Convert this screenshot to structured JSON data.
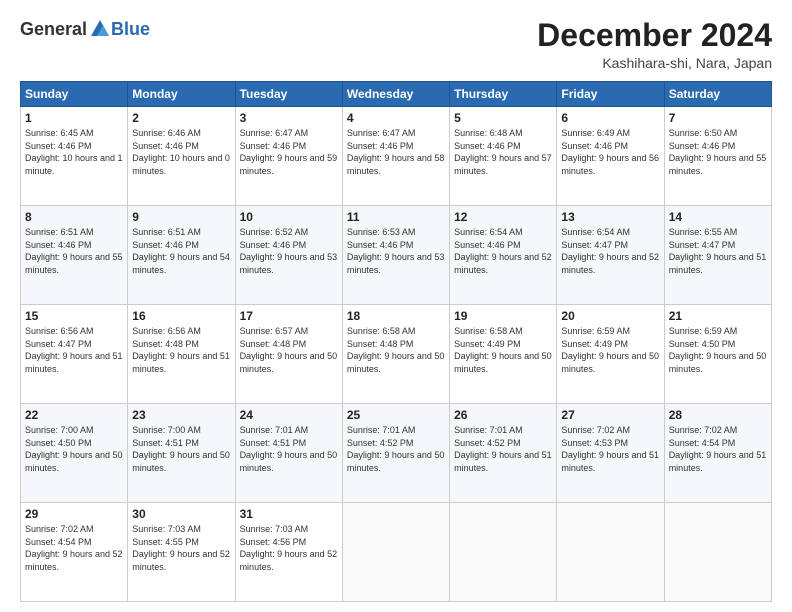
{
  "header": {
    "logo_general": "General",
    "logo_blue": "Blue",
    "month_title": "December 2024",
    "location": "Kashihara-shi, Nara, Japan"
  },
  "days_of_week": [
    "Sunday",
    "Monday",
    "Tuesday",
    "Wednesday",
    "Thursday",
    "Friday",
    "Saturday"
  ],
  "weeks": [
    [
      {
        "day": "1",
        "sunrise": "6:45 AM",
        "sunset": "4:46 PM",
        "daylight": "10 hours and 1 minute."
      },
      {
        "day": "2",
        "sunrise": "6:46 AM",
        "sunset": "4:46 PM",
        "daylight": "10 hours and 0 minutes."
      },
      {
        "day": "3",
        "sunrise": "6:47 AM",
        "sunset": "4:46 PM",
        "daylight": "9 hours and 59 minutes."
      },
      {
        "day": "4",
        "sunrise": "6:47 AM",
        "sunset": "4:46 PM",
        "daylight": "9 hours and 58 minutes."
      },
      {
        "day": "5",
        "sunrise": "6:48 AM",
        "sunset": "4:46 PM",
        "daylight": "9 hours and 57 minutes."
      },
      {
        "day": "6",
        "sunrise": "6:49 AM",
        "sunset": "4:46 PM",
        "daylight": "9 hours and 56 minutes."
      },
      {
        "day": "7",
        "sunrise": "6:50 AM",
        "sunset": "4:46 PM",
        "daylight": "9 hours and 55 minutes."
      }
    ],
    [
      {
        "day": "8",
        "sunrise": "6:51 AM",
        "sunset": "4:46 PM",
        "daylight": "9 hours and 55 minutes."
      },
      {
        "day": "9",
        "sunrise": "6:51 AM",
        "sunset": "4:46 PM",
        "daylight": "9 hours and 54 minutes."
      },
      {
        "day": "10",
        "sunrise": "6:52 AM",
        "sunset": "4:46 PM",
        "daylight": "9 hours and 53 minutes."
      },
      {
        "day": "11",
        "sunrise": "6:53 AM",
        "sunset": "4:46 PM",
        "daylight": "9 hours and 53 minutes."
      },
      {
        "day": "12",
        "sunrise": "6:54 AM",
        "sunset": "4:46 PM",
        "daylight": "9 hours and 52 minutes."
      },
      {
        "day": "13",
        "sunrise": "6:54 AM",
        "sunset": "4:47 PM",
        "daylight": "9 hours and 52 minutes."
      },
      {
        "day": "14",
        "sunrise": "6:55 AM",
        "sunset": "4:47 PM",
        "daylight": "9 hours and 51 minutes."
      }
    ],
    [
      {
        "day": "15",
        "sunrise": "6:56 AM",
        "sunset": "4:47 PM",
        "daylight": "9 hours and 51 minutes."
      },
      {
        "day": "16",
        "sunrise": "6:56 AM",
        "sunset": "4:48 PM",
        "daylight": "9 hours and 51 minutes."
      },
      {
        "day": "17",
        "sunrise": "6:57 AM",
        "sunset": "4:48 PM",
        "daylight": "9 hours and 50 minutes."
      },
      {
        "day": "18",
        "sunrise": "6:58 AM",
        "sunset": "4:48 PM",
        "daylight": "9 hours and 50 minutes."
      },
      {
        "day": "19",
        "sunrise": "6:58 AM",
        "sunset": "4:49 PM",
        "daylight": "9 hours and 50 minutes."
      },
      {
        "day": "20",
        "sunrise": "6:59 AM",
        "sunset": "4:49 PM",
        "daylight": "9 hours and 50 minutes."
      },
      {
        "day": "21",
        "sunrise": "6:59 AM",
        "sunset": "4:50 PM",
        "daylight": "9 hours and 50 minutes."
      }
    ],
    [
      {
        "day": "22",
        "sunrise": "7:00 AM",
        "sunset": "4:50 PM",
        "daylight": "9 hours and 50 minutes."
      },
      {
        "day": "23",
        "sunrise": "7:00 AM",
        "sunset": "4:51 PM",
        "daylight": "9 hours and 50 minutes."
      },
      {
        "day": "24",
        "sunrise": "7:01 AM",
        "sunset": "4:51 PM",
        "daylight": "9 hours and 50 minutes."
      },
      {
        "day": "25",
        "sunrise": "7:01 AM",
        "sunset": "4:52 PM",
        "daylight": "9 hours and 50 minutes."
      },
      {
        "day": "26",
        "sunrise": "7:01 AM",
        "sunset": "4:52 PM",
        "daylight": "9 hours and 51 minutes."
      },
      {
        "day": "27",
        "sunrise": "7:02 AM",
        "sunset": "4:53 PM",
        "daylight": "9 hours and 51 minutes."
      },
      {
        "day": "28",
        "sunrise": "7:02 AM",
        "sunset": "4:54 PM",
        "daylight": "9 hours and 51 minutes."
      }
    ],
    [
      {
        "day": "29",
        "sunrise": "7:02 AM",
        "sunset": "4:54 PM",
        "daylight": "9 hours and 52 minutes."
      },
      {
        "day": "30",
        "sunrise": "7:03 AM",
        "sunset": "4:55 PM",
        "daylight": "9 hours and 52 minutes."
      },
      {
        "day": "31",
        "sunrise": "7:03 AM",
        "sunset": "4:56 PM",
        "daylight": "9 hours and 52 minutes."
      },
      null,
      null,
      null,
      null
    ]
  ]
}
